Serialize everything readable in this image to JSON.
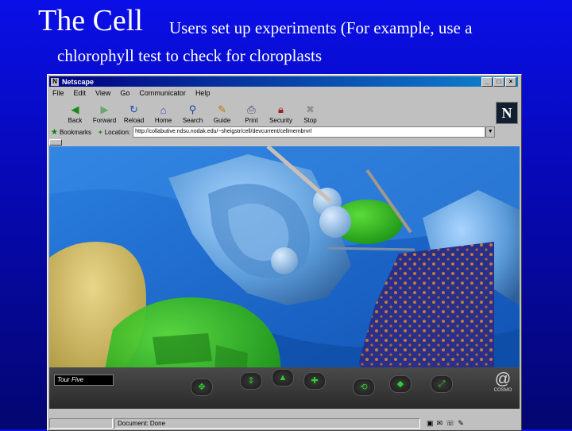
{
  "slide": {
    "title": "The Cell",
    "subtitle_line1": "Users set up experiments (For example, use a",
    "subtitle_line2": "chlorophyll test to check for cloroplasts"
  },
  "browser": {
    "window_title": "Netscape",
    "window_buttons": [
      "_",
      "□",
      "×"
    ],
    "menu": [
      "File",
      "Edit",
      "View",
      "Go",
      "Communicator",
      "Help"
    ],
    "toolbar": [
      {
        "label": "Back",
        "icon": "back-arrow-icon"
      },
      {
        "label": "Forward",
        "icon": "forward-arrow-icon"
      },
      {
        "label": "Reload",
        "icon": "reload-icon"
      },
      {
        "label": "Home",
        "icon": "home-icon"
      },
      {
        "label": "Search",
        "icon": "search-icon"
      },
      {
        "label": "Guide",
        "icon": "guide-icon"
      },
      {
        "label": "Print",
        "icon": "print-icon"
      },
      {
        "label": "Security",
        "icon": "security-lock-icon"
      },
      {
        "label": "Stop",
        "icon": "stop-icon"
      }
    ],
    "logo": "N",
    "bookmarks_label": "Bookmarks",
    "location_label": "Location:",
    "location_url": "http://collabutive.ndsu.nodak.edu/~sheigstr/cell/devcurrent/cellmembrvrl",
    "status_text": "Document: Done",
    "colors": {
      "titlebar": "#000080",
      "chrome": "#c0c0c0"
    }
  },
  "viewer": {
    "tour_label": "Tour Five",
    "brand": "COSMO"
  }
}
